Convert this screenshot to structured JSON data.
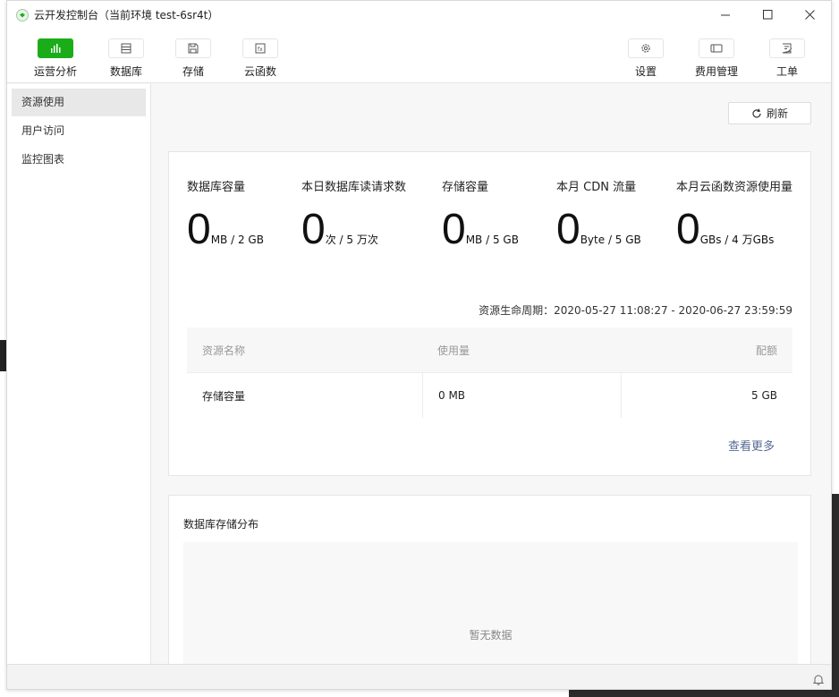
{
  "window": {
    "title": "云开发控制台（当前环境 test-6sr4t）"
  },
  "toolbar": {
    "left": [
      {
        "label": "运营分析",
        "icon": "chart-icon",
        "active": true
      },
      {
        "label": "数据库",
        "icon": "database-icon",
        "active": false
      },
      {
        "label": "存储",
        "icon": "storage-icon",
        "active": false
      },
      {
        "label": "云函数",
        "icon": "function-icon",
        "active": false
      }
    ],
    "right": [
      {
        "label": "设置",
        "icon": "gear-icon"
      },
      {
        "label": "费用管理",
        "icon": "billing-icon"
      },
      {
        "label": "工单",
        "icon": "ticket-icon"
      }
    ]
  },
  "sidebar": {
    "items": [
      {
        "label": "资源使用",
        "active": true
      },
      {
        "label": "用户访问",
        "active": false
      },
      {
        "label": "监控图表",
        "active": false
      }
    ]
  },
  "refresh_label": "刷新",
  "stats": [
    {
      "title": "数据库容量",
      "value": "0",
      "unit": "MB / 2 GB"
    },
    {
      "title": "本日数据库读请求数",
      "value": "0",
      "unit": "次 / 5 万次"
    },
    {
      "title": "存储容量",
      "value": "0",
      "unit": "MB / 5 GB"
    },
    {
      "title": "本月 CDN 流量",
      "value": "0",
      "unit": "Byte / 5 GB"
    },
    {
      "title": "本月云函数资源使用量",
      "value": "0",
      "unit": "GBs / 4 万GBs"
    }
  ],
  "lifecycle": "资源生命周期：2020-05-27 11:08:27 - 2020-06-27 23:59:59",
  "table": {
    "headers": [
      "资源名称",
      "使用量",
      "配额"
    ],
    "rows": [
      [
        "存储容量",
        "0 MB",
        "5 GB"
      ]
    ]
  },
  "see_more": "查看更多",
  "db_dist": {
    "title": "数据库存储分布",
    "empty": "暂无数据"
  },
  "colors": {
    "accent": "#1aad19",
    "link": "#576b95"
  }
}
